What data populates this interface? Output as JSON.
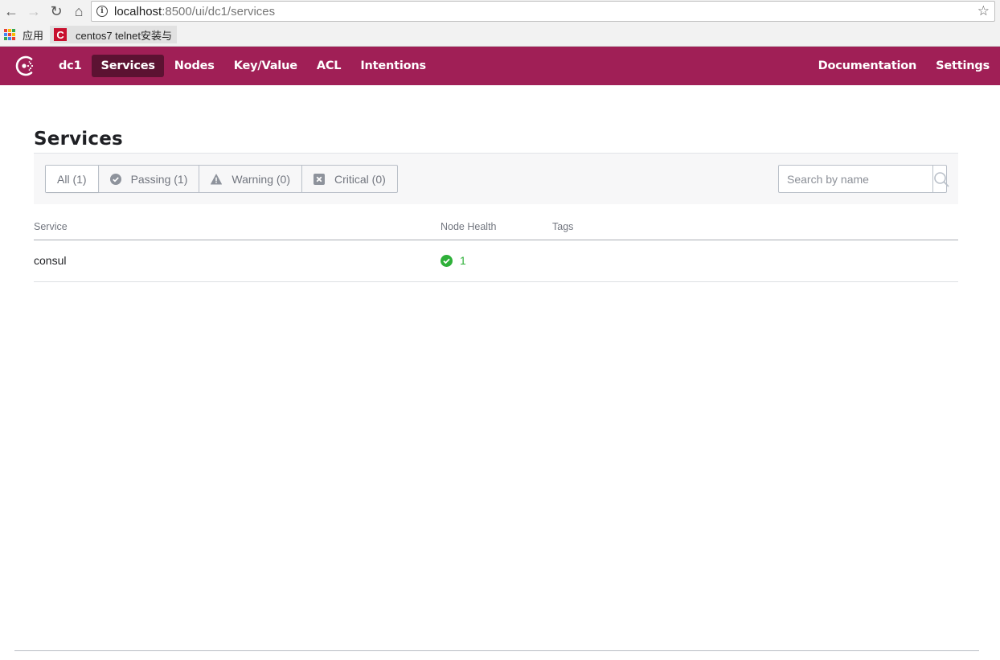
{
  "browser": {
    "url_host": "localhost",
    "url_path": ":8500/ui/dc1/services",
    "bookmarks_apps_label": "应用",
    "bookmarks": [
      {
        "label": "centos7 telnet安装与"
      }
    ],
    "icons": [
      "back-icon",
      "forward-icon",
      "reload-icon",
      "home-icon",
      "info-icon",
      "star-icon",
      "apps-icon"
    ]
  },
  "header": {
    "brand_color": "#a01f56",
    "datacenter": "dc1",
    "nav": [
      {
        "label": "Services",
        "active": true
      },
      {
        "label": "Nodes",
        "active": false
      },
      {
        "label": "Key/Value",
        "active": false
      },
      {
        "label": "ACL",
        "active": false
      },
      {
        "label": "Intentions",
        "active": false
      }
    ],
    "nav_right": [
      {
        "label": "Documentation"
      },
      {
        "label": "Settings"
      }
    ]
  },
  "page": {
    "title": "Services",
    "filters": [
      {
        "label": "All (1)",
        "icon": "none",
        "selected": true
      },
      {
        "label": "Passing (1)",
        "icon": "check-circle-icon",
        "selected": false
      },
      {
        "label": "Warning (0)",
        "icon": "warning-icon",
        "selected": false
      },
      {
        "label": "Critical (0)",
        "icon": "x-square-icon",
        "selected": false
      }
    ],
    "search": {
      "placeholder": "Search by name",
      "value": ""
    },
    "table": {
      "columns": [
        "Service",
        "Node Health",
        "Tags"
      ],
      "rows": [
        {
          "service": "consul",
          "node_health": "1",
          "health_status": "passing",
          "tags": ""
        }
      ]
    },
    "passing_color": "#2eb039"
  }
}
